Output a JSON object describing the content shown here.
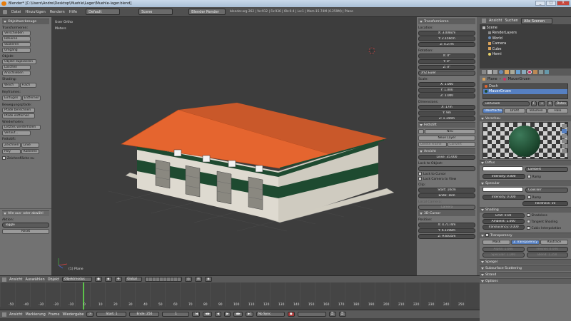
{
  "window": {
    "title": "Blender* [C:\\Users\\Andre\\Desktop\\Muehle\\Lager\\Muehle-lager.blend]",
    "buttons": {
      "minimize": "_",
      "maximize": "□",
      "close": "X"
    }
  },
  "menubar": {
    "items": [
      "Datei",
      "Hinzufügen",
      "Rendern",
      "Hilfe"
    ],
    "layout": "Default",
    "scene": "Scene",
    "renderer": "Blender Render",
    "stats": "blender.org 262 | Ve:912 | Fa:936 | Ob:0-4 | La:1 | Mem:15.74M (6.259M) | Plane"
  },
  "toolshelf": {
    "title": "Objektwerkzeuge",
    "sections": [
      {
        "heading": "Transformieren:",
        "buttons": [
          "Verschieben",
          "Rotieren",
          "Skalieren",
          "Umgang"
        ]
      },
      {
        "heading": "Objekt:",
        "buttons": [
          "Objekt duplizieren",
          "Löschen",
          "Anschließen"
        ]
      },
      {
        "heading": "Shading:",
        "rows": [
          [
            "Weich",
            "Flach"
          ]
        ]
      },
      {
        "heading": "Keyframes:",
        "rows": [
          [
            "Einfügen",
            "Entfernen"
          ]
        ]
      },
      {
        "heading": "Bewegungspfade:",
        "buttons": [
          "Pfade berechnen",
          "Pfade entfernen"
        ]
      },
      {
        "heading": "Wiederholen:",
        "buttons": [
          "Letztes wiederholen",
          "Verlauf..."
        ]
      },
      {
        "heading": "Fettstift:",
        "rows": [
          [
            "Zeichnen",
            "Linie"
          ],
          [
            "Poly",
            "Radieren"
          ]
        ]
      }
    ],
    "checkbox": "Zeichenfläche nu",
    "operator": {
      "title": "Alle aus- oder abwähl",
      "action_label": "Aktion:",
      "action_value": "Toggle",
      "reset": "Reset"
    }
  },
  "viewport": {
    "view_label": "User Ortho",
    "units_label": "Meters",
    "object_label": "(1) Plane",
    "header": {
      "items": [
        "Ansicht",
        "Auswählen",
        "Objekt"
      ],
      "mode": "Objektmodus",
      "pivot": "Global"
    }
  },
  "npanel": {
    "transform_title": "Transformieren",
    "location_label": "Location:",
    "location": [
      "X: 3.008cm",
      "Y: 2.159cm",
      "Z: 4.27m"
    ],
    "rotation_label": "Rotation:",
    "rotation": [
      "X: 0°",
      "Y: 0°",
      "Z: 0°"
    ],
    "rotation_mode": "XYZ Euler",
    "scale_label": "Scale:",
    "scale": [
      "X: 1.000",
      "Y: 1.000",
      "Z: 1.000"
    ],
    "dimensions_label": "Dimensions:",
    "dimensions": [
      "X: 17m",
      "Y: 9m",
      "Z: 1.144m"
    ],
    "grease_title": "Fettstift",
    "grease_new": "Neu",
    "new_layer": "Neue Layer",
    "delete_frame": "Delete Frame",
    "convert": "Convert",
    "view_title": "Ansicht",
    "lens": "Linse: 35.000",
    "lock_object_label": "Lock to Object:",
    "lock_cursor": "Lock to Cursor",
    "lock_camera": "Lock Camera to View",
    "clip_label": "Clip:",
    "clip_start": "Start: 10cm",
    "clip_end": "Ende: 1km",
    "local_camera_label": "Local Camera:",
    "camera": "Camera",
    "cursor_title": "3D-Cursor",
    "position_label": "Position:",
    "cursor": [
      "X: 4.7174m",
      "Y: 6.1198m",
      "Z: 9.6035m"
    ]
  },
  "outliner": {
    "header_items": [
      "Ansicht",
      "Suchen"
    ],
    "filter": "Alle Szenen",
    "items": [
      "Scene",
      "RenderLayers",
      "World",
      "Camera",
      "Cube",
      "Hemi"
    ]
  },
  "properties": {
    "breadcrumb": [
      "Plane",
      "MauerGruen"
    ],
    "materials": [
      "Dach",
      "MauerGruen"
    ],
    "material_name": "uerGruen",
    "data_label": "Daten",
    "tabs": [
      "Oberfläche",
      "Draht",
      "Volumen",
      "Halo"
    ],
    "preview_title": "Vorschau",
    "diffuse_title": "Diffus",
    "diffuse_shader": "Lambert",
    "intensity_diffuse": "Intensity: 0.800",
    "ramp": "Ramp",
    "specular_title": "Specular",
    "specular_shader": "CookTorr",
    "intensity_specular": "Intensity: 0.000",
    "ramp2": "Ramp",
    "hardness": "Hardness: 50",
    "shading_title": "Shading",
    "emit": "Emit: 0.00",
    "ambient": "Ambient: 1.000",
    "translucency": "Translucency: 0.000",
    "shadeless": "Shadeless",
    "tangent": "Tangent Shading",
    "cubic": "Cubic Interpolation",
    "transparency_title": "Transparency",
    "transp_tabs": [
      "Mask",
      "Z Transparency",
      "Raytrace"
    ],
    "alpha": "Alpha: 1.000",
    "fresnel": "Fresnel: 0.000",
    "specular_t": "Specular: 1.000",
    "blend": "Blend: 1.250",
    "mirror_title": "Spiegel",
    "sss_title": "Subsurface Scattering",
    "strand_title": "Strand",
    "options_title": "Options"
  },
  "timeline": {
    "ticks": [
      "-50",
      "-40",
      "-30",
      "-20",
      "-10",
      "0",
      "10",
      "20",
      "30",
      "40",
      "50",
      "60",
      "70",
      "80",
      "90",
      "100",
      "110",
      "120",
      "130",
      "140",
      "150",
      "160",
      "170",
      "180",
      "190",
      "200",
      "210",
      "220",
      "230",
      "240",
      "250"
    ],
    "menu": [
      "Ansicht",
      "Markierung",
      "Frame",
      "Wiedergabe"
    ],
    "start": "Start: 1",
    "end": "Ende: 250",
    "current": "1",
    "sync": "No Sync"
  },
  "colors": {
    "roof": "#e5652f",
    "wall": "#dedad0",
    "stripe": "#1e4a30",
    "accent": "#e87d0d",
    "selection": "#5680c2"
  }
}
